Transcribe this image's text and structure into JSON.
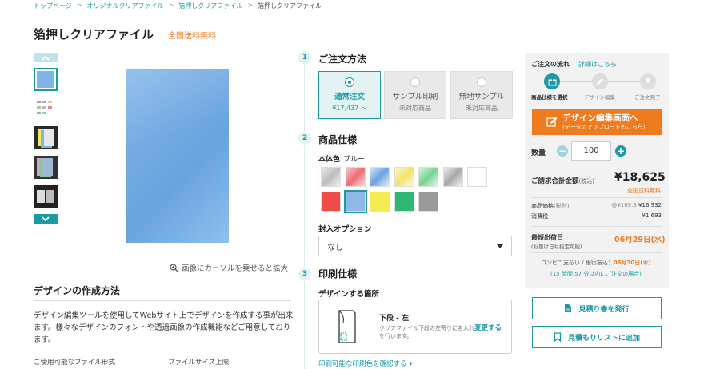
{
  "breadcrumb": [
    "トップページ",
    "オリジナルクリアファイル",
    "箔押しクリアファイル",
    "箔押しクリアファイル"
  ],
  "breadcrumb_sep": ">",
  "title": "箔押しクリアファイル",
  "free_shipping": "全国送料無料",
  "zoom_hint": "画像にカーソルを乗せると拡大",
  "design_method": {
    "heading": "デザインの作成方法",
    "description": "デザイン編集ツールを使用してWebサイト上でデザインを作成する事が出来ます。様々なデザインのフォントや透過画像の作成機能などご用意しております。",
    "file_format_label": "ご使用可能なファイル形式",
    "file_size_label": "ファイルサイズ上限"
  },
  "steps": {
    "step1": {
      "num": "1",
      "title": "ご注文方法"
    },
    "step2": {
      "num": "2",
      "title": "商品仕様"
    },
    "step3": {
      "num": "3",
      "title": "印刷仕様"
    }
  },
  "order_options": [
    {
      "label": "通常注文",
      "sub": "¥17,437 〜"
    },
    {
      "label": "サンプル印刷",
      "sub": "未対応商品"
    },
    {
      "label": "無地サンプル",
      "sub": "未対応商品"
    }
  ],
  "body_color": {
    "label": "本体色",
    "value": "ブルー"
  },
  "swatch_colors": [
    "#cfcfcf",
    "#f49aa0",
    "#9cc7f3",
    "#f7ec9a",
    "#a9e6b9",
    "#c4c4c4",
    "#ffffff",
    "#ee4a4a",
    "#8db8e8",
    "#f4ec52",
    "#2db873",
    "#9a9a9a"
  ],
  "enclosure": {
    "label": "封入オプション",
    "value": "なし"
  },
  "design_location": {
    "label": "デザインする箇所",
    "position_title": "下段 - 左",
    "position_desc": "クリアファイル下段の左寄りに名入れを行います。",
    "change_label": "変更する"
  },
  "print_colors_link": "印刷可能な印刷色を確認する",
  "flow": {
    "title": "ご注文の流れ",
    "link": "詳細はこちら",
    "steps": [
      "商品仕様を選択",
      "デザイン編集",
      "ご注文完了"
    ]
  },
  "design_button": {
    "line1": "デザイン編集画面へ",
    "line2": "(データのアップロードもこちら)"
  },
  "quantity": {
    "label": "数量",
    "value": "100",
    "minus": "−",
    "plus": "+"
  },
  "total": {
    "label": "ご請求合計金額",
    "label_sub": "(税込)",
    "price": "¥18,625",
    "free": "全国送料無料"
  },
  "price_rows": {
    "product": {
      "label": "商品価格",
      "label_sub": "(税別)",
      "unit": "@¥169.3",
      "value": "¥16,932"
    },
    "tax": {
      "label": "消費税",
      "value": "¥1,693"
    }
  },
  "shipping": {
    "label": "最短出荷日",
    "label_sub": "(お届け日も指定可能)",
    "date": "06月29日(水)"
  },
  "conv_note": {
    "prefix": "コンビニ支払い / 銀行振込：",
    "date": "06月30日(木)"
  },
  "conv_note2": "(15 時間 57 分以内にご注文の場合)",
  "buttons": {
    "quote": "見積り書を発行",
    "add_list": "見積もりリストに追加"
  }
}
